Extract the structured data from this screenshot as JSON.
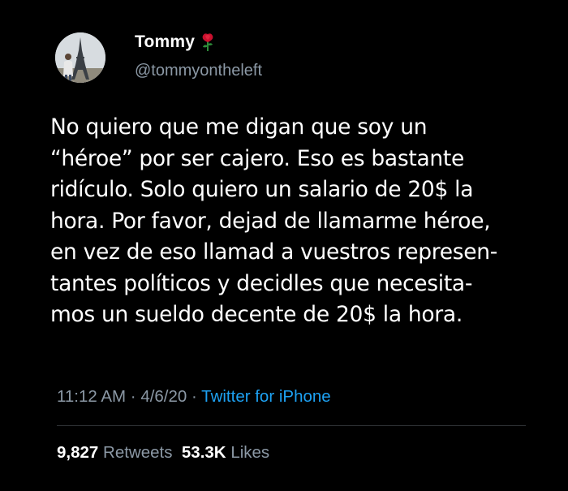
{
  "tweet": {
    "author": {
      "display_name": "Tommy",
      "name_emoji": "rose-icon",
      "handle": "@tommyontheleft",
      "avatar": "avatar-eiffel-tower-photo"
    },
    "text_lines": [
      "No quiero que me digan que soy un",
      "“héroe” por ser cajero. Eso es bastante",
      "ridículo. Solo quiero un salario de 20$ la",
      "hora. Por favor, dejad de llamarme héroe,",
      "en vez de eso llamad a vuestros represen-",
      "tantes políticos y decidles que necesita-",
      "mos un sueldo decente de 20$ la hora."
    ],
    "time": "11:12 AM",
    "separator": " · ",
    "date": "4/6/20",
    "source": "Twitter for iPhone",
    "retweets_count": "9,827",
    "retweets_label": "Retweets",
    "likes_count": "53.3K",
    "likes_label": "Likes"
  },
  "colors": {
    "background": "#000000",
    "text": "#ffffff",
    "muted": "#8b98a5",
    "link": "#1da1f2",
    "divider": "#2f3336",
    "rose": "#c8102e"
  }
}
